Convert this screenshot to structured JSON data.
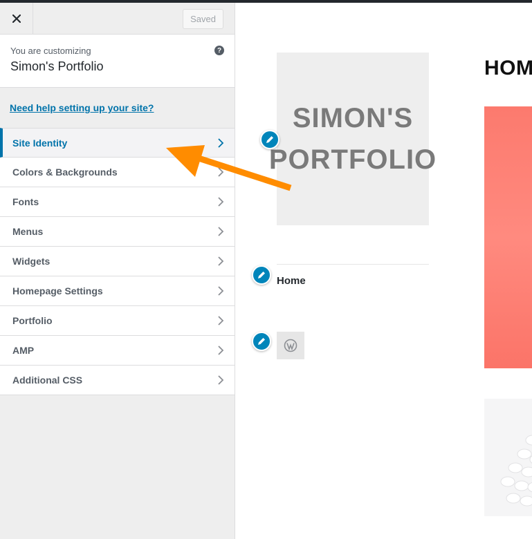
{
  "header": {
    "close_icon": "close-icon",
    "saved_label": "Saved"
  },
  "info": {
    "customizing_label": "You are customizing",
    "site_title": "Simon's Portfolio",
    "help_icon": "question-icon",
    "help_glyph": "?"
  },
  "help_link": "Need help setting up your site?",
  "menu": {
    "items": [
      {
        "label": "Site Identity",
        "active": true
      },
      {
        "label": "Colors & Backgrounds"
      },
      {
        "label": "Fonts"
      },
      {
        "label": "Menus"
      },
      {
        "label": "Widgets"
      },
      {
        "label": "Homepage Settings"
      },
      {
        "label": "Portfolio"
      },
      {
        "label": "AMP"
      },
      {
        "label": "Additional CSS"
      }
    ]
  },
  "preview": {
    "logo_line1": "SIMON'S",
    "logo_line2": "PORTFOLIO",
    "nav_home": "Home",
    "page_heading": "HOME",
    "hero_color": "#fc7a6e"
  },
  "colors": {
    "accent": "#0073aa",
    "pencil": "#0085ba",
    "annotation_arrow": "#ff8c00"
  }
}
